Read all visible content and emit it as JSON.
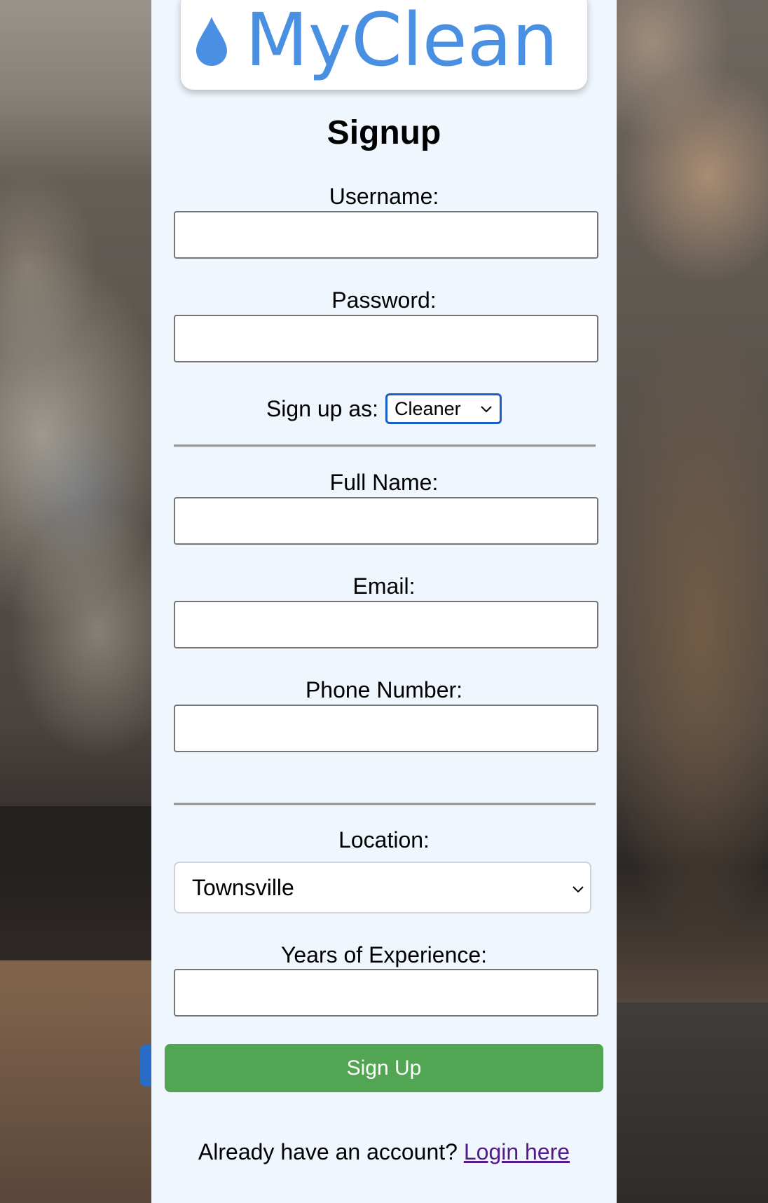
{
  "brand": {
    "name": "MyClean",
    "color": "#4a90e2",
    "icon": "water-drop-icon"
  },
  "form": {
    "title": "Signup",
    "username": {
      "label": "Username:",
      "value": ""
    },
    "password": {
      "label": "Password:",
      "value": ""
    },
    "role": {
      "label": "Sign up as:",
      "selected": "Cleaner"
    },
    "full_name": {
      "label": "Full Name:",
      "value": ""
    },
    "email": {
      "label": "Email:",
      "value": ""
    },
    "phone": {
      "label": "Phone Number:",
      "value": ""
    },
    "location": {
      "label": "Location:",
      "selected": "Townsville"
    },
    "experience": {
      "label": "Years of Experience:",
      "value": ""
    },
    "submit_label": "Sign Up",
    "submit_color": "#52a552"
  },
  "footer": {
    "prompt": "Already have an account?",
    "login_link": "Login here"
  }
}
